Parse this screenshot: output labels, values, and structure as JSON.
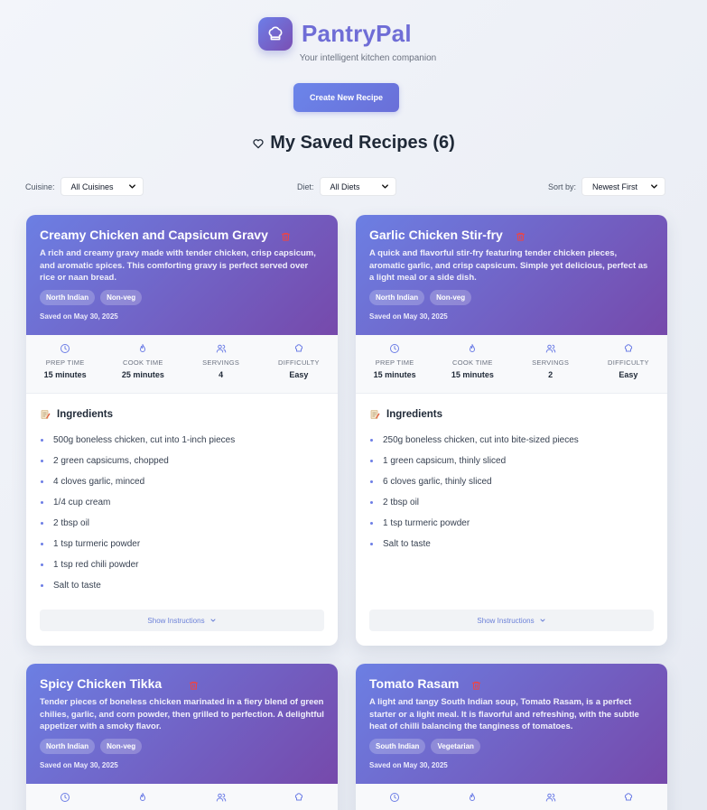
{
  "app": {
    "name": "PantryPal",
    "tagline": "Your intelligent kitchen companion",
    "logo_icon": "chef-hat-icon",
    "create_button": "Create New Recipe"
  },
  "section": {
    "title": "My Saved Recipes (6)",
    "icon": "heart-outline-icon"
  },
  "filters": {
    "cuisine_label": "Cuisine:",
    "cuisine_value": "All Cuisines",
    "diet_label": "Diet:",
    "diet_value": "All Diets",
    "sort_label": "Sort by:",
    "sort_value": "Newest First"
  },
  "stat_labels": {
    "prep": "PREP TIME",
    "cook": "COOK TIME",
    "servings": "SERVINGS",
    "difficulty": "DIFFICULTY"
  },
  "ingredients_heading": "Ingredients",
  "show_instructions_label": "Show Instructions",
  "colors": {
    "accent": "#6f6dd6",
    "header_gradient_start": "#6c7fe3",
    "header_gradient_end": "#7649ab",
    "delete": "#ef4444"
  },
  "recipes": [
    {
      "title": "Creamy Chicken and Capsicum Gravy",
      "description": "A rich and creamy gravy made with tender chicken, crisp capsicum, and aromatic spices. This comforting gravy is perfect served over rice or naan bread.",
      "cuisine": "North Indian",
      "diet": "Non-veg",
      "saved": "Saved on May 30, 2025",
      "prep_time": "15 minutes",
      "cook_time": "25 minutes",
      "servings": "4",
      "difficulty": "Easy",
      "ingredients": [
        "500g boneless chicken, cut into 1-inch pieces",
        "2 green capsicums, chopped",
        "4 cloves garlic, minced",
        "1/4 cup cream",
        "2 tbsp oil",
        "1 tsp turmeric powder",
        "1 tsp red chili powder",
        "Salt to taste"
      ]
    },
    {
      "title": "Garlic Chicken Stir-fry",
      "description": "A quick and flavorful stir-fry featuring tender chicken pieces, aromatic garlic, and crisp capsicum. Simple yet delicious, perfect as a light meal or a side dish.",
      "cuisine": "North Indian",
      "diet": "Non-veg",
      "saved": "Saved on May 30, 2025",
      "prep_time": "15 minutes",
      "cook_time": "15 minutes",
      "servings": "2",
      "difficulty": "Easy",
      "ingredients": [
        "250g boneless chicken, cut into bite-sized pieces",
        "1 green capsicum, thinly sliced",
        "6 cloves garlic, thinly sliced",
        "2 tbsp oil",
        "1 tsp turmeric powder",
        "Salt to taste"
      ]
    },
    {
      "title": "Spicy Chicken Tikka",
      "description": "Tender pieces of boneless chicken marinated in a fiery blend of green chilies, garlic, and corn powder, then grilled to perfection. A delightful appetizer with a smoky flavor.",
      "cuisine": "North Indian",
      "diet": "Non-veg",
      "saved": "Saved on May 30, 2025"
    },
    {
      "title": "Tomato Rasam",
      "description": "A light and tangy South Indian soup, Tomato Rasam, is a perfect starter or a light meal. It is flavorful and refreshing, with the subtle heat of chilli balancing the tanginess of tomatoes.",
      "cuisine": "South Indian",
      "diet": "Vegetarian",
      "saved": "Saved on May 30, 2025"
    }
  ]
}
